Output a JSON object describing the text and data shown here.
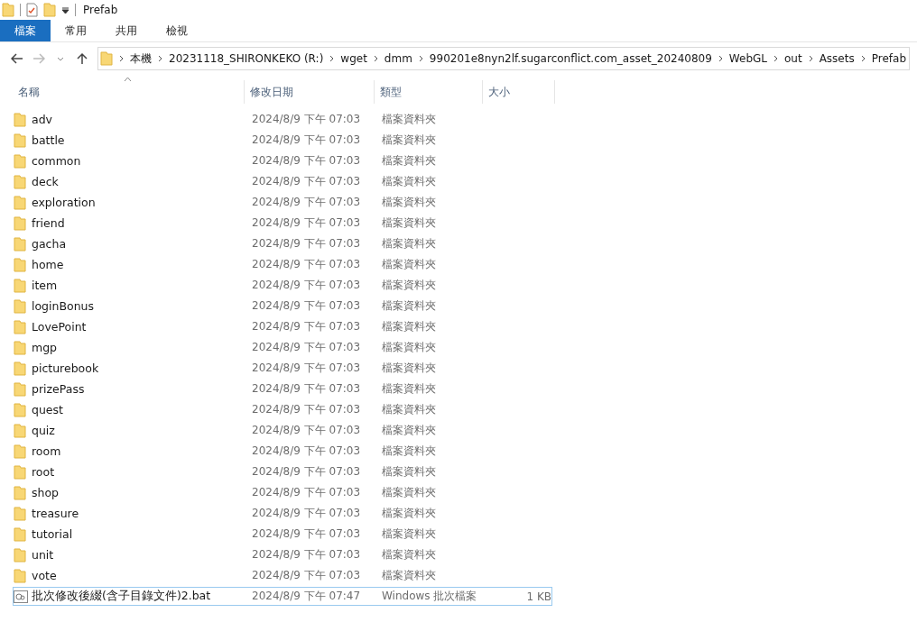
{
  "window": {
    "title": "Prefab"
  },
  "ribbon_tabs": [
    {
      "label": "檔案",
      "selected": true
    },
    {
      "label": "常用",
      "selected": false
    },
    {
      "label": "共用",
      "selected": false
    },
    {
      "label": "檢視",
      "selected": false
    }
  ],
  "breadcrumb": [
    "本機",
    "20231118_SHIRONKEKO (R:)",
    "wget",
    "dmm",
    "990201e8nyn2lf.sugarconflict.com_asset_20240809",
    "WebGL",
    "out",
    "Assets",
    "Prefab"
  ],
  "columns": [
    "名稱",
    "修改日期",
    "類型",
    "大小"
  ],
  "rows": [
    {
      "kind": "folder",
      "name": "adv",
      "date": "2024/8/9 下午 07:03",
      "type": "檔案資料夾",
      "focused": false
    },
    {
      "kind": "folder",
      "name": "battle",
      "date": "2024/8/9 下午 07:03",
      "type": "檔案資料夾",
      "focused": false
    },
    {
      "kind": "folder",
      "name": "common",
      "date": "2024/8/9 下午 07:03",
      "type": "檔案資料夾",
      "focused": false
    },
    {
      "kind": "folder",
      "name": "deck",
      "date": "2024/8/9 下午 07:03",
      "type": "檔案資料夾",
      "focused": false
    },
    {
      "kind": "folder",
      "name": "exploration",
      "date": "2024/8/9 下午 07:03",
      "type": "檔案資料夾",
      "focused": false
    },
    {
      "kind": "folder",
      "name": "friend",
      "date": "2024/8/9 下午 07:03",
      "type": "檔案資料夾",
      "focused": false
    },
    {
      "kind": "folder",
      "name": "gacha",
      "date": "2024/8/9 下午 07:03",
      "type": "檔案資料夾",
      "focused": false
    },
    {
      "kind": "folder",
      "name": "home",
      "date": "2024/8/9 下午 07:03",
      "type": "檔案資料夾",
      "focused": false
    },
    {
      "kind": "folder",
      "name": "item",
      "date": "2024/8/9 下午 07:03",
      "type": "檔案資料夾",
      "focused": false
    },
    {
      "kind": "folder",
      "name": "loginBonus",
      "date": "2024/8/9 下午 07:03",
      "type": "檔案資料夾",
      "focused": false
    },
    {
      "kind": "folder",
      "name": "LovePoint",
      "date": "2024/8/9 下午 07:03",
      "type": "檔案資料夾",
      "focused": false
    },
    {
      "kind": "folder",
      "name": "mgp",
      "date": "2024/8/9 下午 07:03",
      "type": "檔案資料夾",
      "focused": false
    },
    {
      "kind": "folder",
      "name": "picturebook",
      "date": "2024/8/9 下午 07:03",
      "type": "檔案資料夾",
      "focused": false
    },
    {
      "kind": "folder",
      "name": "prizePass",
      "date": "2024/8/9 下午 07:03",
      "type": "檔案資料夾",
      "focused": false
    },
    {
      "kind": "folder",
      "name": "quest",
      "date": "2024/8/9 下午 07:03",
      "type": "檔案資料夾",
      "focused": false
    },
    {
      "kind": "folder",
      "name": "quiz",
      "date": "2024/8/9 下午 07:03",
      "type": "檔案資料夾",
      "focused": false
    },
    {
      "kind": "folder",
      "name": "room",
      "date": "2024/8/9 下午 07:03",
      "type": "檔案資料夾",
      "focused": false
    },
    {
      "kind": "folder",
      "name": "root",
      "date": "2024/8/9 下午 07:03",
      "type": "檔案資料夾",
      "focused": false
    },
    {
      "kind": "folder",
      "name": "shop",
      "date": "2024/8/9 下午 07:03",
      "type": "檔案資料夾",
      "focused": false
    },
    {
      "kind": "folder",
      "name": "treasure",
      "date": "2024/8/9 下午 07:03",
      "type": "檔案資料夾",
      "focused": false
    },
    {
      "kind": "folder",
      "name": "tutorial",
      "date": "2024/8/9 下午 07:03",
      "type": "檔案資料夾",
      "focused": false
    },
    {
      "kind": "folder",
      "name": "unit",
      "date": "2024/8/9 下午 07:03",
      "type": "檔案資料夾",
      "focused": false
    },
    {
      "kind": "folder",
      "name": "vote",
      "date": "2024/8/9 下午 07:03",
      "type": "檔案資料夾",
      "focused": false
    },
    {
      "kind": "batch",
      "name": "批次修改後綴(含子目錄文件)2.bat",
      "date": "2024/8/9 下午 07:47",
      "type": "Windows 批次檔案",
      "size": "1 KB",
      "focused": true
    }
  ]
}
